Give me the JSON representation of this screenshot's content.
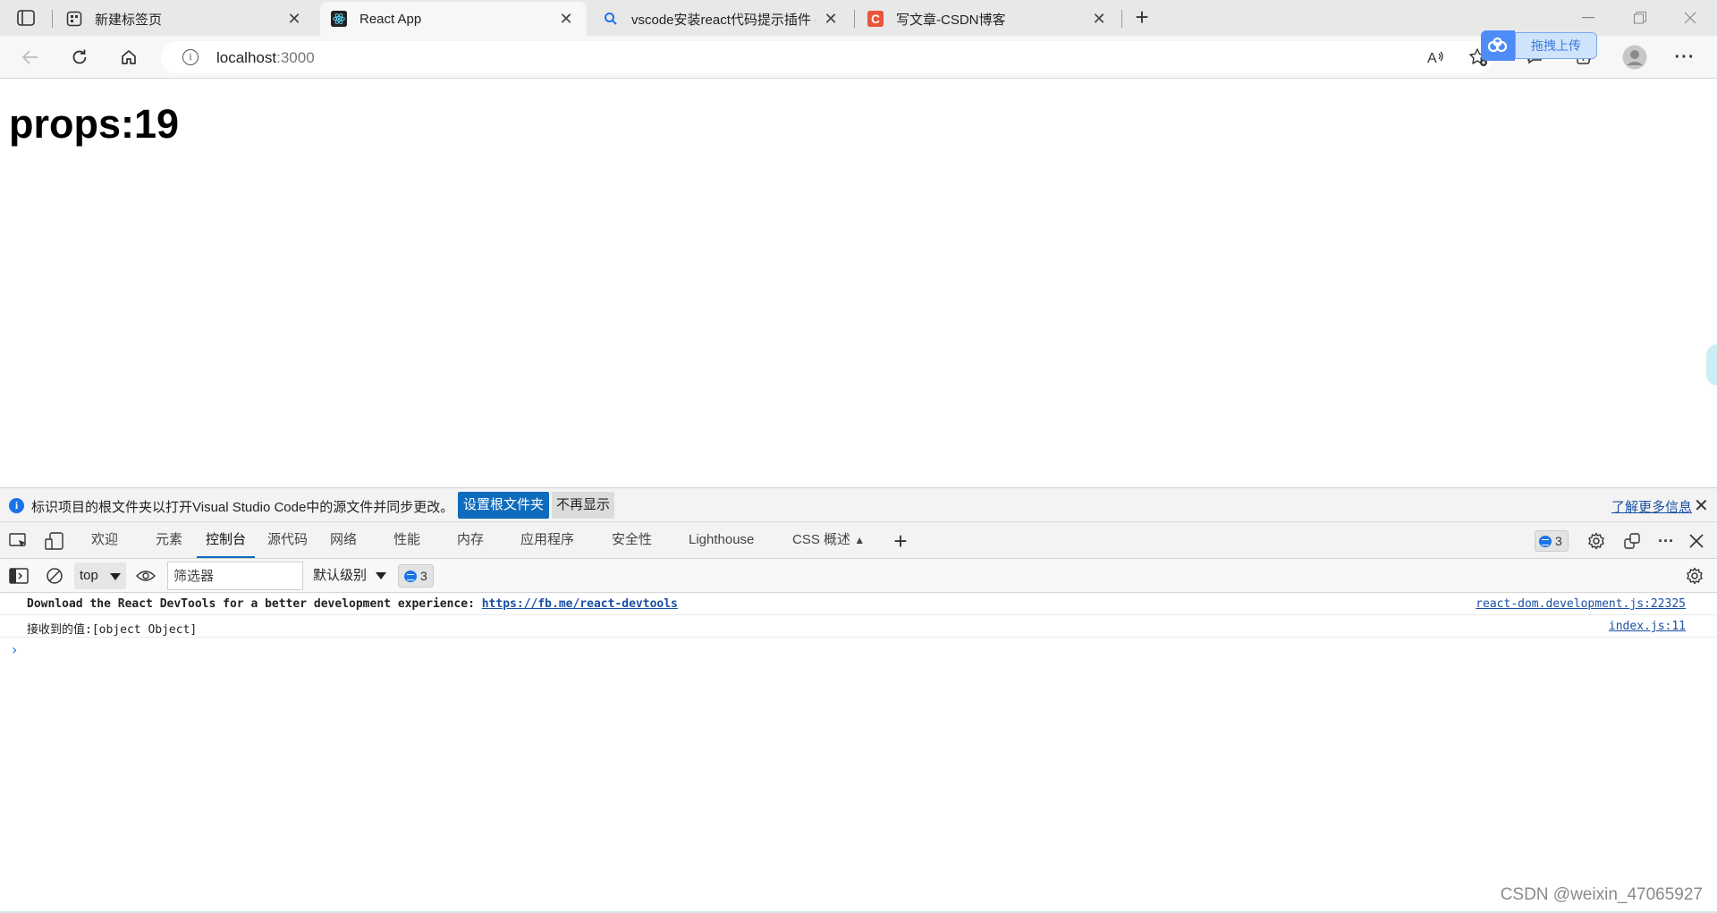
{
  "browser": {
    "tabs": [
      {
        "title": "新建标签页",
        "icon": "new-tab-page-icon",
        "active": false
      },
      {
        "title": "React App",
        "icon": "react-logo-icon",
        "active": true
      },
      {
        "title": "vscode安装react代码提示插件 - ",
        "icon": "search-icon",
        "active": false
      },
      {
        "title": "写文章-CSDN博客",
        "icon": "csdn-logo-icon",
        "active": false
      }
    ],
    "new_tab_symbol": "+",
    "address": {
      "host": "localhost",
      "port": ":3000"
    },
    "baidu_upload_label": "拖拽上传",
    "menu_symbol": "···"
  },
  "page": {
    "heading": "props:19"
  },
  "devtools": {
    "infobar": {
      "message": "标识项目的根文件夹以打开Visual Studio Code中的源文件并同步更改。",
      "primary_button": "设置根文件夹",
      "secondary_button": "不再显示",
      "learn_more": "了解更多信息"
    },
    "tabs": [
      "欢迎",
      "元素",
      "控制台",
      "源代码",
      "网络",
      "性能",
      "内存",
      "应用程序",
      "安全性",
      "Lighthouse",
      "CSS 概述"
    ],
    "active_tab": "控制台",
    "issues_count": "3",
    "console_toolbar": {
      "context": "top",
      "filter_placeholder": "筛选器",
      "level": "默认级别",
      "issues_count": "3"
    },
    "console_messages": [
      {
        "text": "Download the React DevTools for a better development experience: ",
        "link": "https://fb.me/react-devtools",
        "source": "react-dom.development.js:22325"
      },
      {
        "text": "接收到的值:[object Object]",
        "source": "index.js:11"
      }
    ],
    "prompt_symbol": "›"
  },
  "watermark": "CSDN @weixin_47065927"
}
